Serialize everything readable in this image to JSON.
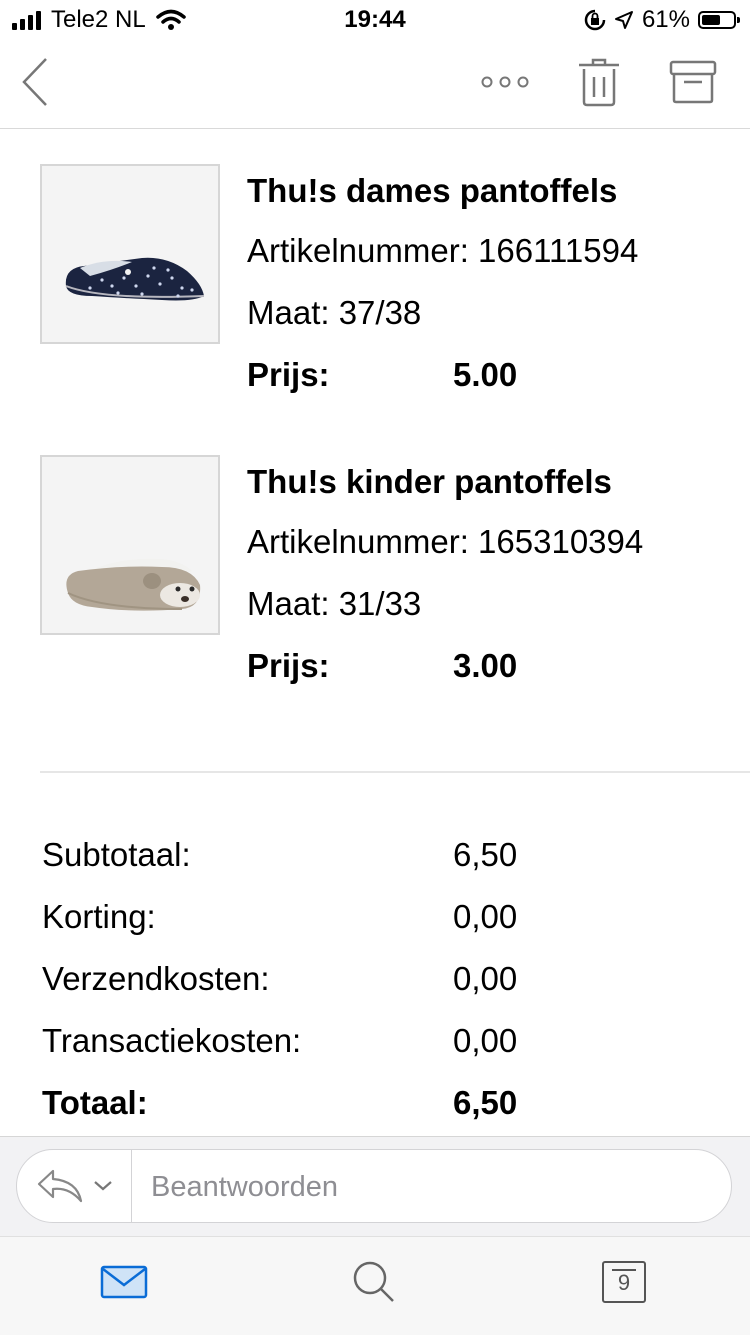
{
  "status_bar": {
    "carrier": "Tele2 NL",
    "time": "19:44",
    "battery": "61%",
    "battery_level": 0.61,
    "icons": [
      "signal-icon",
      "wifi-icon",
      "orientation-lock-icon",
      "location-icon",
      "battery-icon"
    ]
  },
  "nav": {
    "icons": [
      "back-chevron-icon",
      "more-icon",
      "trash-icon",
      "archive-icon"
    ]
  },
  "products": [
    {
      "title": "Thu!s dames pantoffels",
      "sku": "Artikelnummer: 166111594",
      "size": "Maat: 37/38",
      "price_label": "Prijs:",
      "price": "5.00",
      "image": "navy-dotted-slipper"
    },
    {
      "title": "Thu!s kinder pantoffels",
      "sku": "Artikelnummer: 165310394",
      "size": "Maat: 31/33",
      "price_label": "Prijs:",
      "price": "3.00",
      "image": "beige-bear-slipper"
    }
  ],
  "totals": [
    {
      "label": "Subtotaal:",
      "value": "6,50",
      "bold": false
    },
    {
      "label": "Korting:",
      "value": "0,00",
      "bold": false
    },
    {
      "label": "Verzendkosten:",
      "value": "0,00",
      "bold": false
    },
    {
      "label": "Transactiekosten:",
      "value": "0,00",
      "bold": false
    },
    {
      "label": "Totaal:",
      "value": "6,50",
      "bold": true
    }
  ],
  "reply": {
    "placeholder": "Beantwoorden",
    "icons": [
      "reply-icon",
      "chevron-down-icon"
    ]
  },
  "tab_bar": {
    "calendar_day": "9",
    "icons": [
      "mail-icon",
      "search-icon",
      "calendar-icon"
    ],
    "accent_color": "#0a6cd6"
  }
}
